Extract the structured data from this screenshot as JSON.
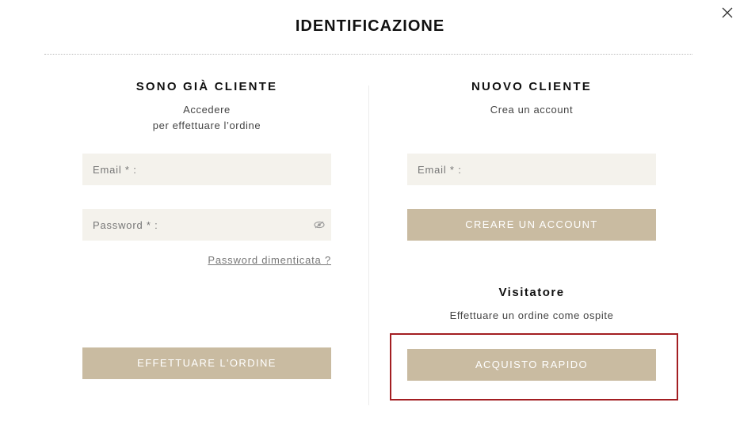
{
  "modal": {
    "title": "IDENTIFICAZIONE",
    "close_icon": "close-icon"
  },
  "existing_customer": {
    "title": "SONO GIÀ CLIENTE",
    "subtitle_line1": "Accedere",
    "subtitle_line2": "per effettuare l’ordine",
    "email_placeholder": "Email * :",
    "email_value": "",
    "password_placeholder": "Password * :",
    "password_value": "",
    "show_password_icon": "eye-icon",
    "forgot_password_label": "Password dimenticata ?",
    "submit_label": "EFFETTUARE L'ORDINE"
  },
  "new_customer": {
    "title": "NUOVO CLIENTE",
    "subtitle": "Crea un account",
    "email_placeholder": "Email * :",
    "email_value": "",
    "create_account_label": "CREARE UN ACCOUNT"
  },
  "guest": {
    "title": "Visitatore",
    "subtitle": "Effettuare un ordine come ospite",
    "quick_purchase_label": "ACQUISTO RAPIDO"
  },
  "colors": {
    "button_bg": "#c9bba1",
    "field_bg": "#f4f2ec",
    "highlight": "#a31e22"
  }
}
